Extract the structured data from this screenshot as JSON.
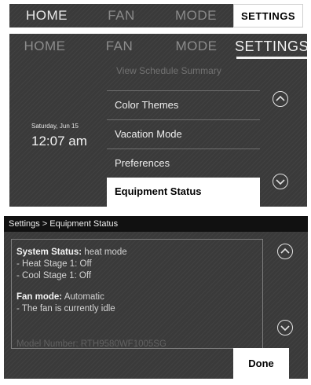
{
  "top_tabs": [
    "HOME",
    "FAN",
    "MODE",
    "SETTINGS"
  ],
  "settings_screen": {
    "tabs": [
      "HOME",
      "FAN",
      "MODE",
      "SETTINGS"
    ],
    "date": "Saturday, Jun 15",
    "time": "12:07 am",
    "menu_faded": "View Schedule Summary",
    "menu_items": [
      "Color Themes",
      "Vacation Mode",
      "Preferences",
      "Equipment Status"
    ],
    "selected_item": "Equipment Status"
  },
  "equipment_status": {
    "breadcrumb": "Settings > Equipment Status",
    "system_status_label": "System Status:",
    "system_status_value": "heat mode",
    "heat_stage": "- Heat Stage 1: Off",
    "cool_stage": "- Cool Stage 1: Off",
    "fan_mode_label": "Fan mode:",
    "fan_mode_value": "Automatic",
    "fan_state": "- The fan is currently idle",
    "model_number": "Model Number: RTH9580WF1005SG",
    "done_label": "Done"
  },
  "icons": [
    "chevron-up-icon",
    "chevron-down-icon"
  ],
  "colors": {
    "panel_bg": "#3a3a3a",
    "selected_bg": "#ffffff",
    "header_bg": "#111111"
  }
}
